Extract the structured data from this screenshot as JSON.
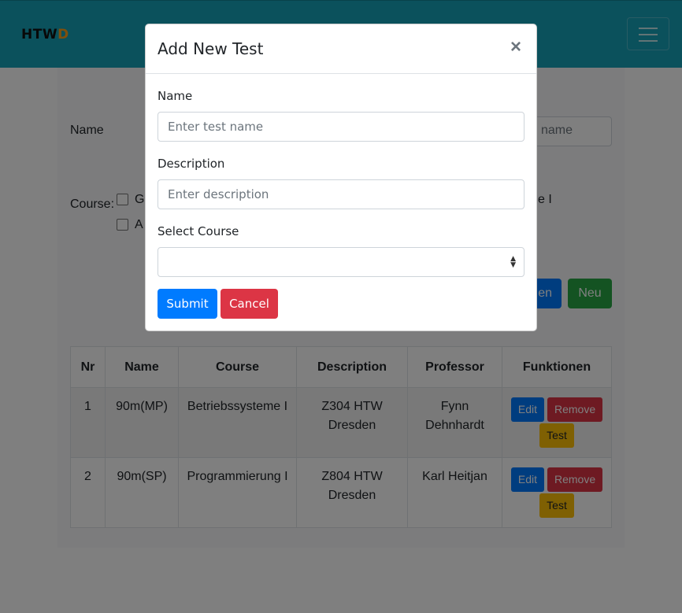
{
  "navbar": {
    "brand_main": "HTW",
    "brand_accent": "D"
  },
  "form": {
    "name_label": "Name",
    "name_placeholder_visible": "name",
    "course_label": "Course:",
    "course_opt1_prefix": "G",
    "course_opt1_suffix": "e I",
    "course_opt2_prefix": "A",
    "search_button_suffix": "en",
    "new_button": "Neu"
  },
  "table": {
    "headers": [
      "Nr",
      "Name",
      "Course",
      "Description",
      "Professor",
      "Funktionen"
    ],
    "rows": [
      {
        "nr": "1",
        "name": "90m(MP)",
        "course": "Betriebssysteme I",
        "description": "Z304 HTW Dresden",
        "professor": "Fynn Dehnhardt"
      },
      {
        "nr": "2",
        "name": "90m(SP)",
        "course": "Programmierung I",
        "description": "Z804 HTW Dresden",
        "professor": "Karl Heitjan"
      }
    ],
    "actions": {
      "edit": "Edit",
      "remove": "Remove",
      "test": "Test"
    }
  },
  "modal": {
    "title": "Add New Test",
    "close_glyph": "×",
    "name_label": "Name",
    "name_placeholder": "Enter test name",
    "description_label": "Description",
    "description_placeholder": "Enter description",
    "course_label": "Select Course",
    "course_value": "",
    "submit": "Submit",
    "cancel": "Cancel"
  },
  "colors": {
    "navbar": "#17a2b8",
    "primary": "#007bff",
    "danger": "#dc3545",
    "success": "#28a745",
    "warning": "#ffc107"
  }
}
